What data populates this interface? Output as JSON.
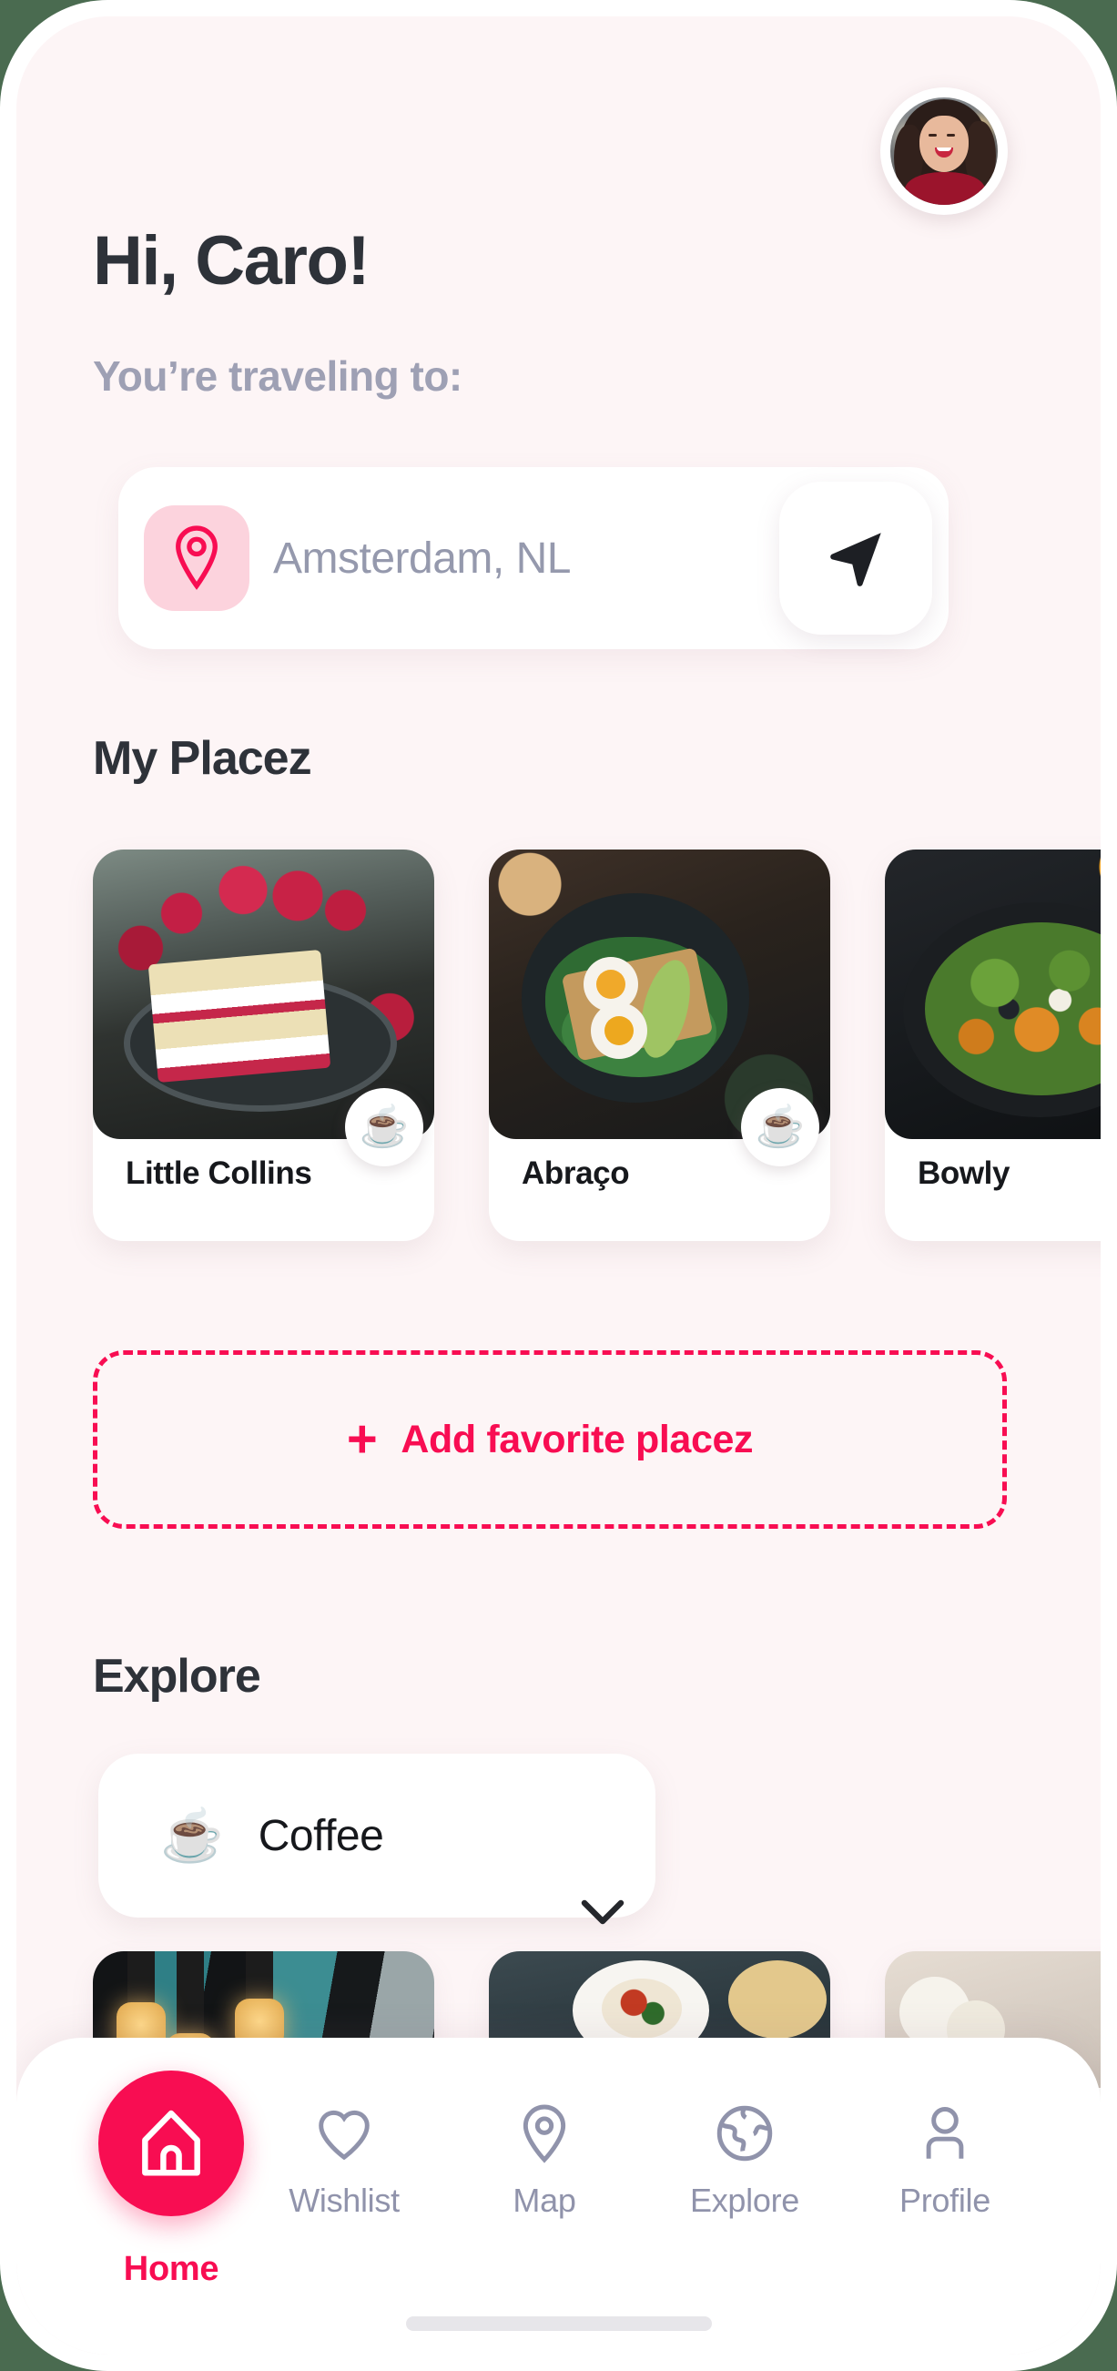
{
  "app": {
    "accent_color": "#f80d52",
    "background_color": "#fdf5f6",
    "outer_color": "#4a6b50",
    "muted_text_color": "#9093ab"
  },
  "header": {
    "greeting": "Hi, Caro!",
    "subtitle": "You’re traveling to:",
    "avatar_alt": "avatar"
  },
  "location": {
    "pin_icon": "map-pin-icon",
    "value": "Amsterdam, NL",
    "placeholder": "Amsterdam, NL",
    "locate_icon": "navigation-arrow-icon"
  },
  "my_placez": {
    "title": "My Placez",
    "cards": [
      {
        "name": "Little Collins",
        "badge": "☕",
        "badge_name": "coffee-badge",
        "image": "raspberry-cake-photo"
      },
      {
        "name": "Abraço",
        "badge": "☕",
        "badge_name": "coffee-badge",
        "image": "egg-avocado-toast-photo"
      },
      {
        "name": "Bowly",
        "badge": "",
        "badge_name": "",
        "image": "salad-bowl-photo"
      }
    ],
    "add_button": {
      "plus": "+",
      "label": "Add favorite placez"
    }
  },
  "explore": {
    "title": "Explore",
    "filter": {
      "emoji": "☕",
      "label": "Coffee",
      "chevron_icon": "chevron-down-icon"
    },
    "cards": [
      {
        "image": "cafe-interior-pendant-lights-photo"
      },
      {
        "image": "restaurant-table-spread-photo"
      },
      {
        "image": "plated-dish-with-flowers-photo"
      }
    ]
  },
  "bottom_nav": {
    "home": {
      "label": "Home",
      "icon": "home-icon",
      "active": true
    },
    "items": [
      {
        "label": "Wishlist",
        "icon": "heart-icon",
        "active": false
      },
      {
        "label": "Map",
        "icon": "map-pin-icon",
        "active": false
      },
      {
        "label": "Explore",
        "icon": "globe-icon",
        "active": false
      },
      {
        "label": "Profile",
        "icon": "person-icon",
        "active": false
      }
    ]
  }
}
